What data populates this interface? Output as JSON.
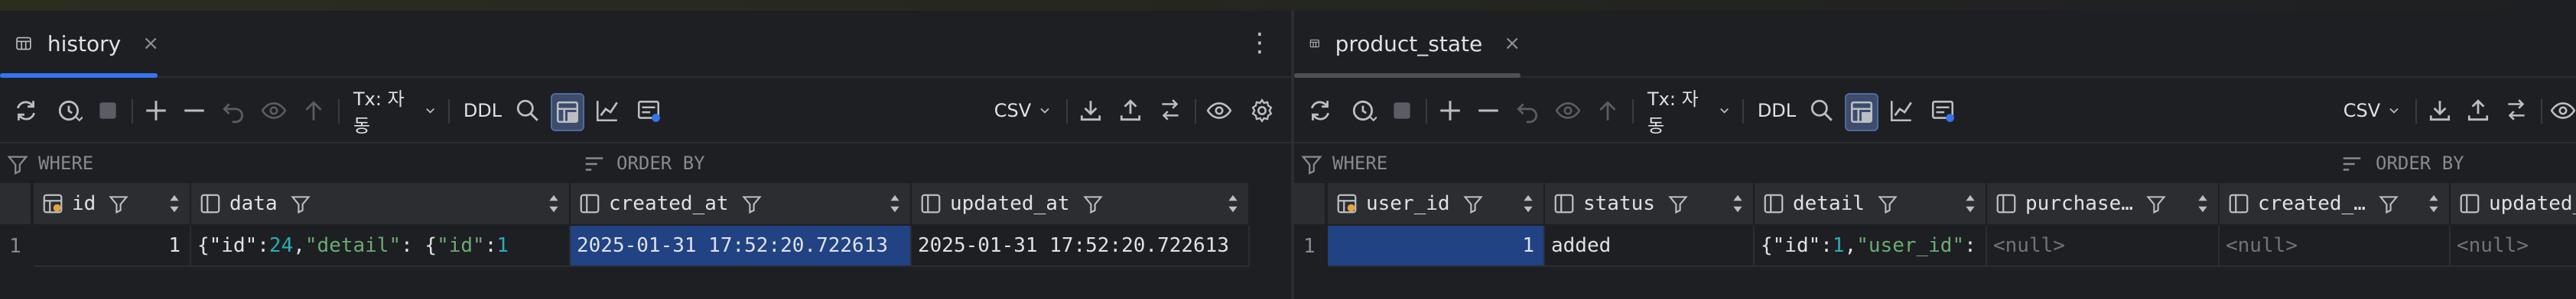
{
  "left": {
    "tab": {
      "label": "history",
      "close": "×",
      "more": "⋮"
    },
    "toolbar": {
      "tx": "Tx: 자동",
      "ddl": "DDL",
      "csv": "CSV"
    },
    "filter": {
      "where": "WHERE",
      "order_by": "ORDER BY"
    },
    "columns": [
      {
        "name": "id"
      },
      {
        "name": "data"
      },
      {
        "name": "created_at"
      },
      {
        "name": "updated_at"
      }
    ],
    "rows": [
      {
        "rownum": "1",
        "id": "1",
        "data": {
          "p1": "{\"id\": ",
          "v1": "24",
          "p2": ", ",
          "k2": "\"detail\"",
          "p3": ": {",
          "k3": "\"id\"",
          "p4": ": ",
          "v4": "1"
        },
        "created_at": "2025-01-31 17:52:20.722613",
        "updated_at": "2025-01-31 17:52:20.722613"
      }
    ]
  },
  "right": {
    "tab": {
      "label": "product_state",
      "close": "×"
    },
    "toolbar": {
      "tx": "Tx: 자동",
      "ddl": "DDL",
      "csv": "CSV"
    },
    "filter": {
      "where": "WHERE",
      "order_by": "ORDER BY"
    },
    "columns": [
      {
        "name": "user_id"
      },
      {
        "name": "status"
      },
      {
        "name": "detail"
      },
      {
        "name": "purchase…"
      },
      {
        "name": "created_…"
      },
      {
        "name": "updated_"
      }
    ],
    "rows": [
      {
        "rownum": "1",
        "user_id": "1",
        "status": "added",
        "detail": {
          "p1": "{\"id\":",
          "v1": "1",
          "p2": ",",
          "k2": "\"user_id\"",
          "p3": ":"
        },
        "purchase": "<null>",
        "created": "<null>",
        "updated": "<null>"
      }
    ]
  },
  "colors": {
    "background": "#1e1f22",
    "header": "#2b2d30",
    "accent": "#3574f0",
    "selection": "#214283"
  }
}
